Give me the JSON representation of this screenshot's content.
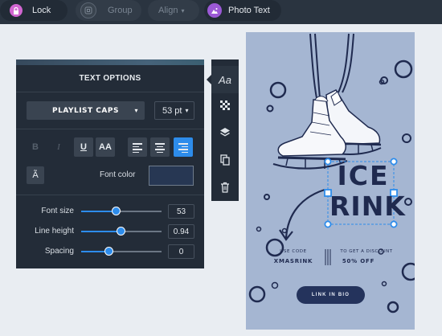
{
  "toolbar": {
    "lock": "Lock",
    "group": "Group",
    "align": "Align",
    "photo_text": "Photo Text"
  },
  "panel": {
    "title": "TEXT OPTIONS",
    "font_family": "PLAYLIST CAPS",
    "font_size_select": "53 pt",
    "format": {
      "bold": "B",
      "italic": "I",
      "underline": "U",
      "caps": "AA"
    },
    "special_char": "Ã",
    "font_color_label": "Font color",
    "font_color_value": "#273753",
    "sliders": [
      {
        "label": "Font size",
        "value": "53",
        "position": 0.43
      },
      {
        "label": "Line height",
        "value": "0.94",
        "position": 0.49
      },
      {
        "label": "Spacing",
        "value": "0",
        "position": 0.34
      }
    ]
  },
  "side_toolbar": {
    "text_icon_label": "Aa",
    "icons": [
      "text-icon",
      "transparency-icon",
      "layers-icon",
      "duplicate-icon",
      "trash-icon"
    ]
  },
  "canvas": {
    "heading_line1": "ICE",
    "heading_line2": "RINK",
    "use_code_label": "USE CODE",
    "code": "XMASRINK",
    "discount_label": "TO GET A DISCOUNT",
    "discount_value": "50% OFF",
    "cta": "LINK IN BIO"
  },
  "colors": {
    "toolbar_bg": "#2a3440",
    "panel_bg": "#232c38",
    "accent_blue": "#2d8ceb",
    "canvas_bg": "#a5b6d2",
    "ink_navy": "#1f2a4f"
  }
}
